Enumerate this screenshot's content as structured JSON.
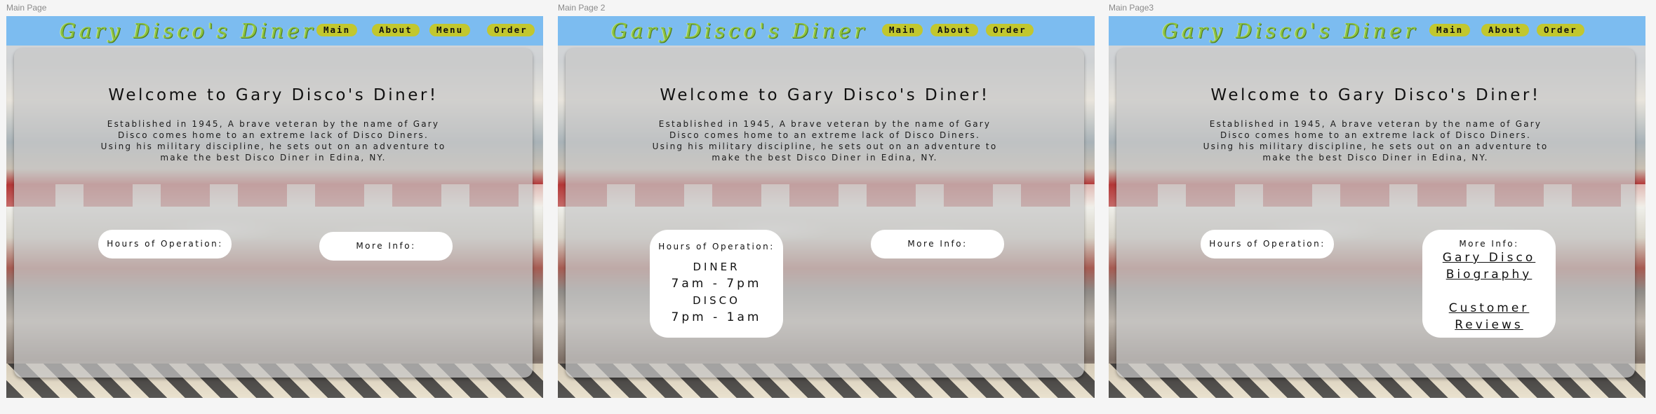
{
  "frames": [
    {
      "label": "Main Page"
    },
    {
      "label": "Main Page 2"
    },
    {
      "label": "Main Page3"
    }
  ],
  "nav": {
    "logo": "Gary Disco's Diner",
    "links": [
      "Main",
      "About",
      "Menu",
      "Order"
    ],
    "links_page2": [
      "Main",
      "About",
      "Order"
    ],
    "color": "#7cbcf0",
    "button_color": "#c2c72e",
    "logo_color": "#8bc13e"
  },
  "welcome": {
    "title": "Welcome to Gary Disco's Diner!",
    "lines": [
      "Established in 1945, A brave veteran by the name of Gary",
      "Disco comes home to an extreme lack of Disco Diners.",
      "Using his military discipline, he sets out on an adventure to",
      "make the best Disco Diner in Edina, NY."
    ]
  },
  "hours": {
    "label": "Hours of Operation:",
    "diner_title": "DINER",
    "diner_hours": "7am - 7pm",
    "disco_title": "DISCO",
    "disco_hours": "7pm - 1am"
  },
  "more_info": {
    "label": "More Info:",
    "links": [
      "Gary Disco",
      "Biography",
      "Customer",
      "Reviews"
    ]
  }
}
